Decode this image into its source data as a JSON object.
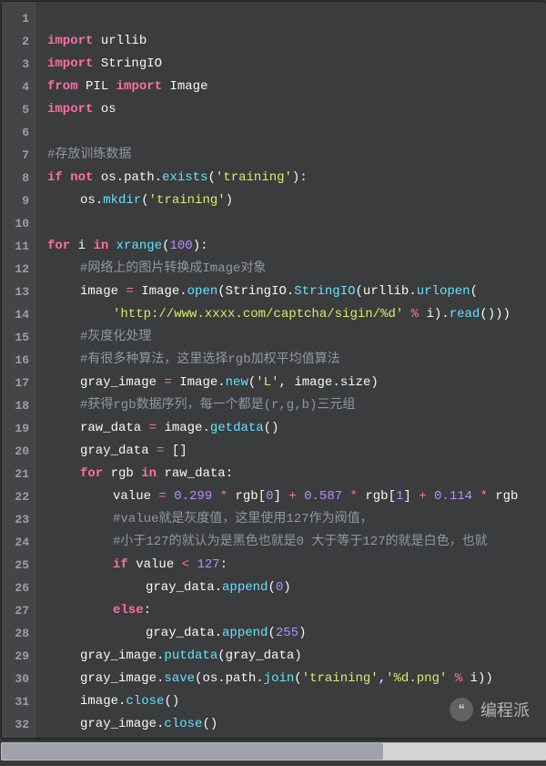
{
  "watermark": {
    "icon": "❝",
    "text": "编程派"
  },
  "scrollbar": {
    "thumb_ratio": 0.7
  },
  "lines": [
    {
      "n": 1,
      "html": ""
    },
    {
      "n": 2,
      "html": "<span class='kw'>import</span> <span class='name'>urllib</span>"
    },
    {
      "n": 3,
      "html": "<span class='kw'>import</span> <span class='name'>StringIO</span>"
    },
    {
      "n": 4,
      "html": "<span class='kw'>from</span> <span class='name'>PIL</span> <span class='kw'>import</span> <span class='name'>Image</span>"
    },
    {
      "n": 5,
      "html": "<span class='kw'>import</span> <span class='name'>os</span>"
    },
    {
      "n": 6,
      "html": ""
    },
    {
      "n": 7,
      "html": "<span class='cmt'>#存放训练数据</span>"
    },
    {
      "n": 8,
      "html": "<span class='kw'>if</span> <span class='kw'>not</span> <span class='name'>os</span><span class='punct'>.</span><span class='name'>path</span><span class='punct'>.</span><span class='func'>exists</span><span class='punct'>(</span><span class='str'>'training'</span><span class='punct'>):</span>"
    },
    {
      "n": 9,
      "indent": "indent1",
      "html": "<span class='name'>os</span><span class='punct'>.</span><span class='func'>mkdir</span><span class='punct'>(</span><span class='str'>'training'</span><span class='punct'>)</span>"
    },
    {
      "n": 10,
      "html": ""
    },
    {
      "n": 11,
      "html": "<span class='kw'>for</span> <span class='name'>i</span> <span class='kw'>in</span> <span class='func'>xrange</span><span class='punct'>(</span><span class='num'>100</span><span class='punct'>):</span>"
    },
    {
      "n": 12,
      "indent": "indent1",
      "html": "<span class='cmt'>#网络上的图片转换成Image对象</span>"
    },
    {
      "n": 13,
      "indent": "indent1",
      "html": "<span class='name'>image</span> <span class='op'>=</span> <span class='name'>Image</span><span class='punct'>.</span><span class='func'>open</span><span class='punct'>(</span><span class='name'>StringIO</span><span class='punct'>.</span><span class='func'>StringIO</span><span class='punct'>(</span><span class='name'>urllib</span><span class='punct'>.</span><span class='func'>urlopen</span><span class='punct'>(</span>"
    },
    {
      "n": 14,
      "indent": "indent2",
      "html": "<span class='str'>'http://www.xxxx.com/captcha/sigin/%d'</span> <span class='op'>%</span> <span class='name'>i</span><span class='punct'>).</span><span class='func'>read</span><span class='punct'>()))</span>"
    },
    {
      "n": 15,
      "indent": "indent1",
      "html": "<span class='cmt'>#灰度化处理</span>"
    },
    {
      "n": 16,
      "indent": "indent1",
      "html": "<span class='cmt'>#有很多种算法，这里选择rgb加权平均值算法</span>"
    },
    {
      "n": 17,
      "indent": "indent1",
      "html": "<span class='name'>gray_image</span> <span class='op'>=</span> <span class='name'>Image</span><span class='punct'>.</span><span class='func'>new</span><span class='punct'>(</span><span class='str'>'L'</span><span class='punct'>,</span> <span class='name'>image</span><span class='punct'>.</span><span class='name'>size</span><span class='punct'>)</span>"
    },
    {
      "n": 18,
      "indent": "indent1",
      "html": "<span class='cmt'>#获得rgb数据序列，每一个都是(r,g,b)三元组</span>"
    },
    {
      "n": 19,
      "indent": "indent1",
      "html": "<span class='name'>raw_data</span> <span class='op'>=</span> <span class='name'>image</span><span class='punct'>.</span><span class='func'>getdata</span><span class='punct'>()</span>"
    },
    {
      "n": 20,
      "indent": "indent1",
      "html": "<span class='name'>gray_data</span> <span class='op'>=</span> <span class='punct'>[]</span>"
    },
    {
      "n": 21,
      "indent": "indent1",
      "html": "<span class='kw'>for</span> <span class='name'>rgb</span> <span class='kw'>in</span> <span class='name'>raw_data</span><span class='punct'>:</span>"
    },
    {
      "n": 22,
      "indent": "indent2",
      "html": "<span class='name'>value</span> <span class='op'>=</span> <span class='num'>0.299</span> <span class='op'>*</span> <span class='name'>rgb</span><span class='punct'>[</span><span class='num'>0</span><span class='punct'>]</span> <span class='op'>+</span> <span class='num'>0.587</span> <span class='op'>*</span> <span class='name'>rgb</span><span class='punct'>[</span><span class='num'>1</span><span class='punct'>]</span> <span class='op'>+</span> <span class='num'>0.114</span> <span class='op'>*</span> <span class='name'>rgb</span>"
    },
    {
      "n": 23,
      "indent": "indent2",
      "html": "<span class='cmt'>#value就是灰度值，这里使用127作为阀值，</span>"
    },
    {
      "n": 24,
      "indent": "indent2",
      "html": "<span class='cmt'>#小于127的就认为是黑色也就是0 大于等于127的就是白色，也就</span>"
    },
    {
      "n": 25,
      "indent": "indent2",
      "html": "<span class='kw'>if</span> <span class='name'>value</span> <span class='op'>&lt;</span> <span class='num'>127</span><span class='punct'>:</span>"
    },
    {
      "n": 26,
      "indent": "indent3",
      "html": "<span class='name'>gray_data</span><span class='punct'>.</span><span class='func'>append</span><span class='punct'>(</span><span class='num'>0</span><span class='punct'>)</span>"
    },
    {
      "n": 27,
      "indent": "indent2",
      "html": "<span class='kw'>else</span><span class='punct'>:</span>"
    },
    {
      "n": 28,
      "indent": "indent3",
      "html": "<span class='name'>gray_data</span><span class='punct'>.</span><span class='func'>append</span><span class='punct'>(</span><span class='num'>255</span><span class='punct'>)</span>"
    },
    {
      "n": 29,
      "indent": "indent1",
      "html": "<span class='name'>gray_image</span><span class='punct'>.</span><span class='func'>putdata</span><span class='punct'>(</span><span class='name'>gray_data</span><span class='punct'>)</span>"
    },
    {
      "n": 30,
      "indent": "indent1",
      "html": "<span class='name'>gray_image</span><span class='punct'>.</span><span class='func'>save</span><span class='punct'>(</span><span class='name'>os</span><span class='punct'>.</span><span class='name'>path</span><span class='punct'>.</span><span class='func'>join</span><span class='punct'>(</span><span class='str'>'training'</span><span class='punct'>,</span><span class='str'>'%d.png'</span> <span class='op'>%</span> <span class='name'>i</span><span class='punct'>))</span>"
    },
    {
      "n": 31,
      "indent": "indent1",
      "html": "<span class='name'>image</span><span class='punct'>.</span><span class='func'>close</span><span class='punct'>()</span>"
    },
    {
      "n": 32,
      "indent": "indent1",
      "html": "<span class='name'>gray_image</span><span class='punct'>.</span><span class='func'>close</span><span class='punct'>()</span>"
    }
  ]
}
